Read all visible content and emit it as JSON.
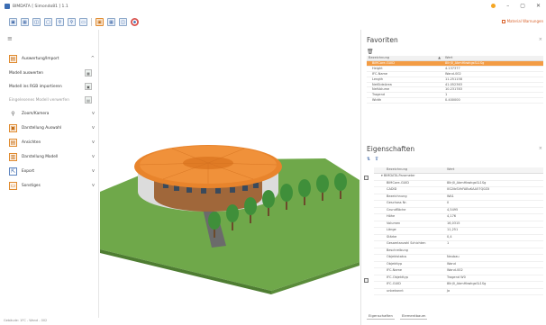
{
  "window": {
    "title": "BIMDATA [ Simondo81 ] 1.1",
    "minimize": "–",
    "maximize": "▢",
    "close": "✕"
  },
  "toolbar": {
    "warning_label": "Material Warnungen"
  },
  "left_panel": {
    "items": [
      {
        "label": "Auswertung/Import",
        "icon": "import-icon",
        "chevron": "^"
      },
      {
        "label": "Zoom/Kamera",
        "icon": "zoom-icon",
        "chevron": "v"
      },
      {
        "label": "Darstellung Auswahl",
        "icon": "selection-icon",
        "chevron": "v"
      },
      {
        "label": "Ansichten",
        "icon": "views-icon",
        "chevron": "v"
      },
      {
        "label": "Darstellung Modell",
        "icon": "model-icon",
        "chevron": "v"
      },
      {
        "label": "Export",
        "icon": "export-icon",
        "chevron": "v"
      },
      {
        "label": "Sonstiges",
        "icon": "folder-icon",
        "chevron": "v"
      }
    ],
    "subitems": [
      {
        "label": "Modell auswerten"
      },
      {
        "label": "Modell ins RGB importieren"
      },
      {
        "label": "Eingelesenes Modell verwerfen"
      }
    ]
  },
  "favoriten": {
    "title": "Favoriten",
    "col1": "Bezeichnung",
    "col2": "Wert",
    "sort_indicator": "▲",
    "rows": [
      {
        "name": "BIMCore-GUID",
        "value": "8IIrj0_AbmHbwkgsSL1Sg",
        "selected": true
      },
      {
        "name": "Height",
        "value": "4.137377"
      },
      {
        "name": "IFC-Name",
        "value": "Wand-002"
      },
      {
        "name": "Length",
        "value": "11.251158"
      },
      {
        "name": "NetSideArea",
        "value": "41.052363"
      },
      {
        "name": "NetVolume",
        "value": "10.231783"
      },
      {
        "name": "Tragend",
        "value": "1"
      },
      {
        "name": "Width",
        "value": "0.400000"
      }
    ]
  },
  "eigenschaften": {
    "title": "Eigenschaften",
    "col1": "Bezeichnung",
    "col2": "Wert",
    "group": "BIMDATA-Parameter",
    "rows": [
      {
        "name": "BIMCore-GUID",
        "value": "8IIrj0_AbmHbwkgsSL1Sg"
      },
      {
        "name": "CADID",
        "value": "0G2ibSVhFABuKAA57Q0ZX"
      },
      {
        "name": "Bezeichnung",
        "value": "WA1"
      },
      {
        "name": "Geschoss Nr.",
        "value": "0"
      },
      {
        "name": "Grundfläche",
        "value": "4,5495"
      },
      {
        "name": "Höhe",
        "value": "4,176"
      },
      {
        "name": "Volumen",
        "value": "16,0315"
      },
      {
        "name": "Länge",
        "value": "11,251"
      },
      {
        "name": "Stärke",
        "value": "0,4"
      },
      {
        "name": "Gesamtanzahl Schichten",
        "value": "1"
      },
      {
        "name": "Beschreibung",
        "value": ""
      },
      {
        "name": "Objektstatus",
        "value": "Neubau"
      },
      {
        "name": "Objekttyp",
        "value": "Wand"
      },
      {
        "name": "IFC-Name",
        "value": "Wand-002"
      },
      {
        "name": "IFC-Objekttyp",
        "value": "Tragend W0"
      },
      {
        "name": "IFC-GUID",
        "value": "8IIrj0_AbmHbwkgsSL1Sg"
      },
      {
        "name": "unbekannt",
        "value": "Ja"
      }
    ]
  },
  "bottom_tabs": [
    "Eigenschaften",
    "Elementbaum"
  ],
  "status": "Gebäude: 1FC - Wand - 002"
}
